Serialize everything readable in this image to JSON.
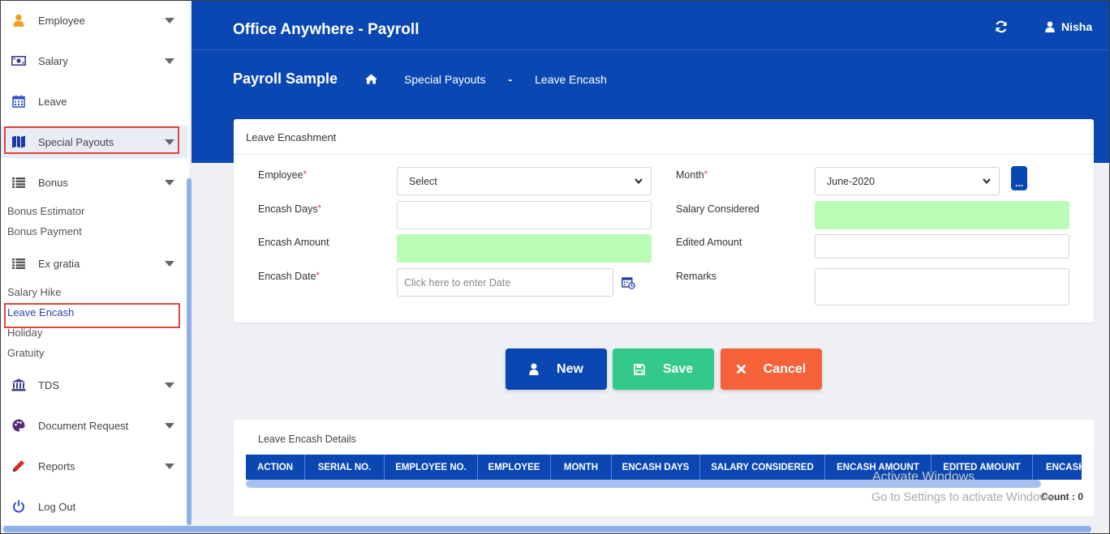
{
  "sidebar": {
    "items": [
      {
        "label": "Employee",
        "icon": "user-icon",
        "has_caret": true
      },
      {
        "label": "Salary",
        "icon": "money-icon",
        "has_caret": true
      },
      {
        "label": "Leave",
        "icon": "calendar-icon",
        "has_caret": false
      },
      {
        "label": "Special Payouts",
        "icon": "map-icon",
        "has_caret": true
      },
      {
        "label": "Bonus",
        "icon": "list-icon",
        "has_caret": true
      },
      {
        "label": "Ex gratia",
        "icon": "list-icon",
        "has_caret": true
      },
      {
        "label": "TDS",
        "icon": "bank-icon",
        "has_caret": true
      },
      {
        "label": "Document Request",
        "icon": "palette-icon",
        "has_caret": true
      },
      {
        "label": "Reports",
        "icon": "pencil-icon",
        "has_caret": true
      },
      {
        "label": "Log Out",
        "icon": "power-icon",
        "has_caret": false
      }
    ],
    "bonus_subitems": [
      "Bonus Estimator",
      "Bonus Payment"
    ],
    "exgratia_subitems": [
      "Salary Hike",
      "Leave Encash",
      "Holiday",
      "Gratuity"
    ]
  },
  "header": {
    "app_title": "Office Anywhere - Payroll",
    "user_name": "Nisha",
    "breadcrumb": {
      "title": "Payroll Sample",
      "section": "Special Payouts",
      "separator": "-",
      "page": "Leave Encash"
    }
  },
  "form": {
    "title": "Leave Encashment",
    "employee_label": "Employee",
    "employee_value": "Select",
    "month_label": "Month",
    "month_value": "June-2020",
    "more_button": "...",
    "encash_days_label": "Encash Days",
    "encash_days_value": "",
    "salary_considered_label": "Salary Considered",
    "salary_considered_value": "",
    "encash_amount_label": "Encash Amount",
    "encash_amount_value": "",
    "edited_amount_label": "Edited Amount",
    "edited_amount_value": "",
    "encash_date_label": "Encash Date",
    "encash_date_placeholder": "Click here to enter Date",
    "remarks_label": "Remarks",
    "remarks_value": "",
    "required_marker": "*"
  },
  "actions": {
    "new_label": "New",
    "save_label": "Save",
    "cancel_label": "Cancel"
  },
  "details": {
    "title": "Leave Encash Details",
    "columns": [
      "ACTION",
      "SERIAL NO.",
      "EMPLOYEE NO.",
      "EMPLOYEE",
      "MONTH",
      "ENCASH DAYS",
      "SALARY CONSIDERED",
      "ENCASH AMOUNT",
      "EDITED AMOUNT",
      "ENCASH"
    ],
    "count_label": "Count : 0"
  },
  "watermark": {
    "line1": "Activate Windows",
    "line2": "Go to Settings to activate Windows."
  },
  "colors": {
    "primary": "#0b47b3",
    "save": "#34c98a",
    "cancel": "#f5623a",
    "readonly_field": "#b8fcb6",
    "highlight": "#e0443c"
  }
}
